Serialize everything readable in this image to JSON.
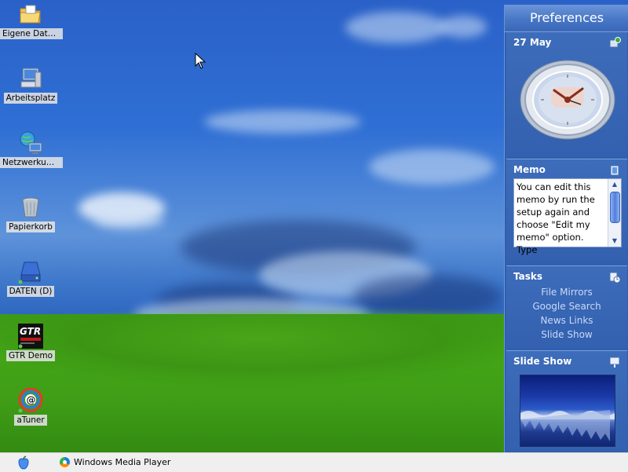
{
  "desktop": {
    "icons": [
      {
        "label": "Eigene Dateien",
        "icon": "folder-icon"
      },
      {
        "label": "Arbeitsplatz",
        "icon": "computer-icon"
      },
      {
        "label": "Netzwerkum...",
        "icon": "network-icon"
      },
      {
        "label": "Papierkorb",
        "icon": "recycle-bin-icon"
      },
      {
        "label": "DATEN (D)",
        "icon": "drive-icon"
      },
      {
        "label": "GTR Demo",
        "icon": "gtr-logo-icon",
        "logo_text": "GTR"
      },
      {
        "label": "aTuner",
        "icon": "atuner-icon",
        "logo_text": "@"
      }
    ]
  },
  "sidebar": {
    "title": "Preferences",
    "date_tile": {
      "date": "27 May"
    },
    "memo": {
      "title": "Memo",
      "text": "You can edit this memo by run the setup again and choose \"Edit my memo\" option. Type"
    },
    "tasks": {
      "title": "Tasks",
      "links": [
        "File Mirrors",
        "Google Search",
        "News Links",
        "Slide Show"
      ]
    },
    "slideshow": {
      "title": "Slide Show"
    }
  },
  "taskbar": {
    "start_icon": "apple-icon",
    "items": [
      {
        "label": "Windows Media Player",
        "icon": "media-player-icon"
      }
    ]
  },
  "colors": {
    "sidebar_bg": "#2f5fb0",
    "sidebar_header": "#4777c6",
    "task_link": "#c9d9f4",
    "taskbar_bg": "#efefef"
  }
}
